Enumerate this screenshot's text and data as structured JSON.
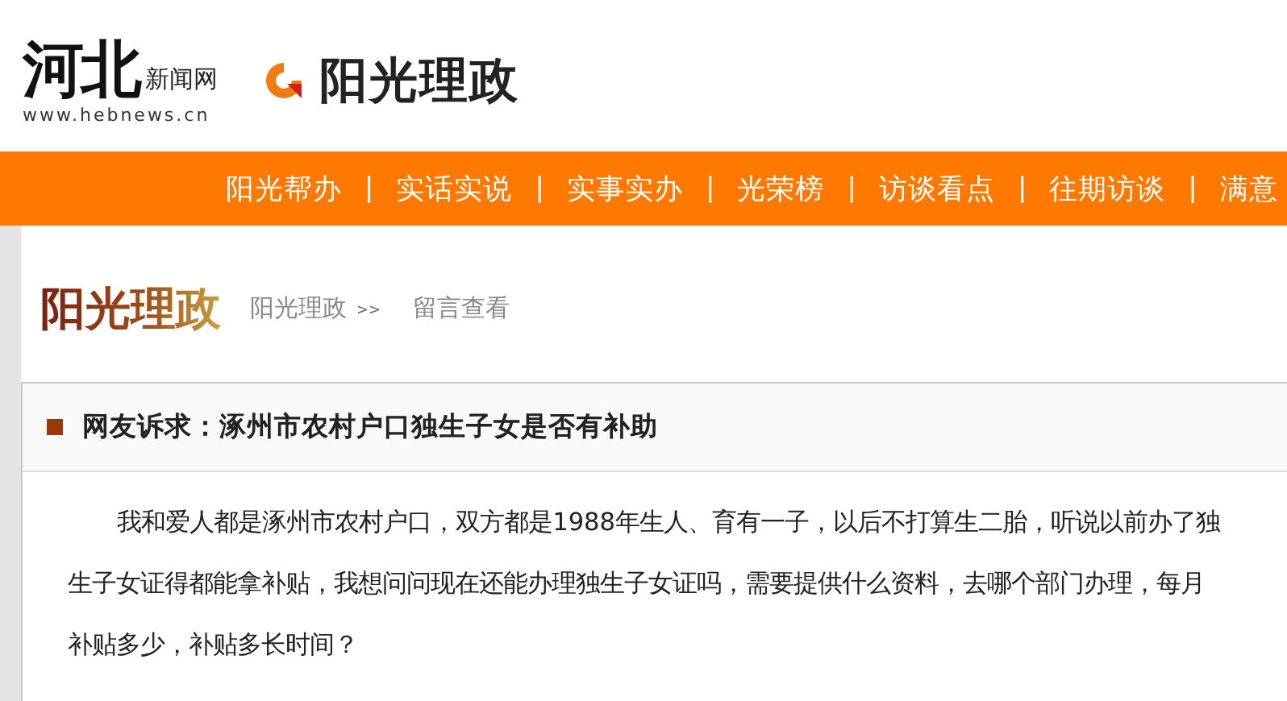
{
  "header": {
    "logo_main": "河北",
    "logo_sub": "新闻网",
    "logo_url": "www.hebnews.cn",
    "brand": "阳光理政"
  },
  "nav": [
    {
      "label": "阳光帮办",
      "separator": "|"
    },
    {
      "label": "实话实说",
      "separator": "|"
    },
    {
      "label": "实事实办",
      "separator": "|"
    },
    {
      "label": "光荣榜",
      "separator": "|"
    },
    {
      "label": "访谈看点",
      "separator": "|"
    },
    {
      "label": "往期访谈",
      "separator": "|"
    },
    {
      "label": "满意"
    }
  ],
  "section": {
    "title": "阳光理政",
    "breadcrumb": [
      {
        "label": "阳光理政",
        "separator": ">>"
      },
      {
        "label": "留言查看"
      }
    ]
  },
  "post": {
    "title": "网友诉求：涿州市农村户口独生子女是否有补助",
    "body": "我和爱人都是涿州市农村户口，双方都是1988年生人、育有一子，以后不打算生二胎，听说以前办了独生子女证得都能拿补贴，我想问问现在还能办理独生子女证吗，需要提供什么资料，去哪个部门办理，每月补贴多少，补贴多长时间？"
  }
}
